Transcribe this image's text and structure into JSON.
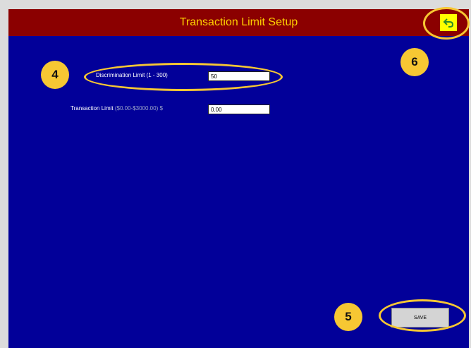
{
  "header": {
    "title": "Transaction Limit Setup",
    "back_icon": "undo-arrow-icon"
  },
  "form": {
    "discrimination_label": "Discrimination Limit (1 - 300)",
    "discrimination_value": "50",
    "transaction_label": "Transaction Limit",
    "transaction_range": "($0.00-$3000.00)",
    "transaction_currency": "$",
    "transaction_value": "0.00"
  },
  "actions": {
    "save_label": "SAVE"
  },
  "callouts": {
    "four": "4",
    "five": "5",
    "six": "6"
  },
  "colors": {
    "background": "#020099",
    "title_bar": "#8b0000",
    "title_text": "#ffd200",
    "callout": "#f7c733",
    "back_button": "#ffff00"
  }
}
